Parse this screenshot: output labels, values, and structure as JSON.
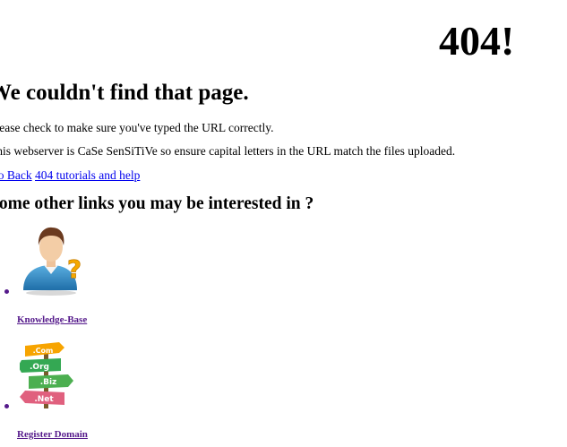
{
  "error": {
    "code": "404!",
    "heading": "We couldn't find that page.",
    "line1": "Please check to make sure you've typed the URL correctly.",
    "line2": "This webserver is CaSe SenSiTiVe so ensure capital letters in the URL match the files uploaded."
  },
  "links": {
    "go_back": "Go Back",
    "tutorials": "404 tutorials and help"
  },
  "other_links": {
    "heading": "Some other links you may be interested in ?",
    "items": [
      {
        "label": "Knowledge-Base",
        "icon": "user-question-icon"
      },
      {
        "label": "Register Domain",
        "icon": "domain-signpost-icon"
      }
    ]
  },
  "signpost_labels": [
    ".Com",
    ".Org",
    ".Biz",
    ".Net"
  ],
  "colors": {
    "link": "#0000ee",
    "visited_link": "#551a8b"
  }
}
